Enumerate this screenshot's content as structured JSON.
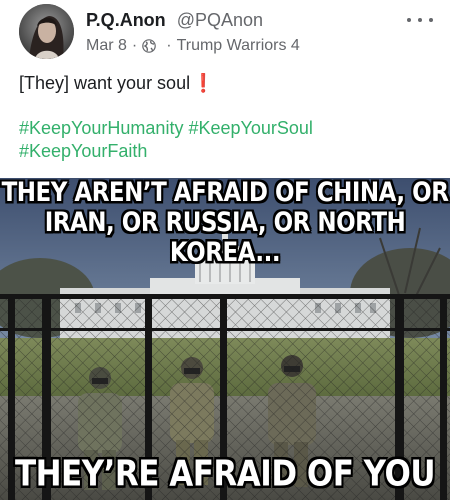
{
  "post": {
    "author_name": "P.Q.Anon",
    "author_handle": "@PQAnon",
    "date": "Mar 8",
    "separator": "·",
    "group": "Trump Warriors 4",
    "text": "[They] want your soul",
    "text_emoji": "❗",
    "hashtags": [
      "#KeepYourHumanity",
      "#KeepYourSoul",
      "#KeepYourFaith"
    ]
  },
  "meme": {
    "caption_top_line1": "THEY AREN’T AFRAID OF CHINA, OR",
    "caption_top_line2": "IRAN, OR RUSSIA, OR NORTH KOREA...",
    "caption_bottom": "THEY’RE AFRAID OF YOU"
  },
  "icons": {
    "visibility": "globe-icon",
    "more": "more-options-icon"
  },
  "colors": {
    "hashtag": "#33b06b",
    "exclaim": "#e0245e",
    "meta": "#65676b"
  }
}
